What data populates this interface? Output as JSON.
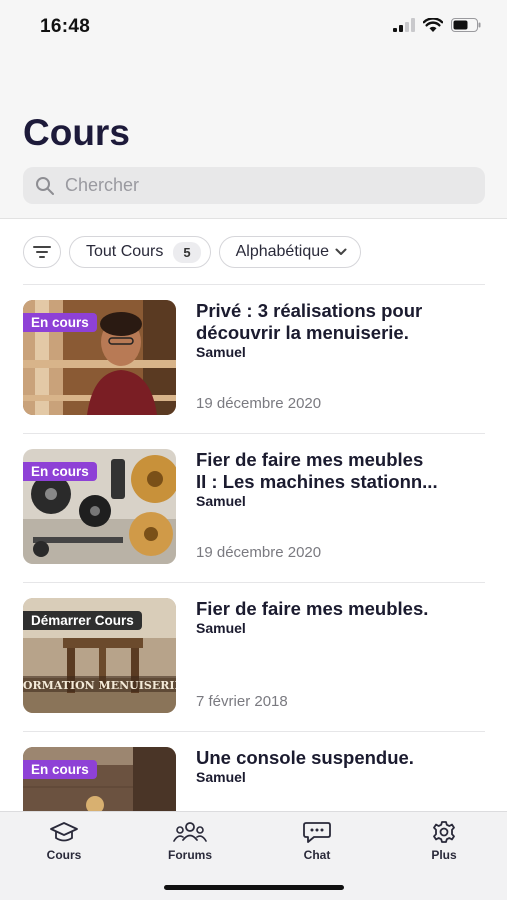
{
  "status_bar": {
    "time": "16:48"
  },
  "header": {
    "title": "Cours",
    "search_placeholder": "Chercher"
  },
  "filters": {
    "all_label": "Tout Cours",
    "all_count": "5",
    "sort_label": "Alphabétique"
  },
  "courses": [
    {
      "badge": "En cours",
      "title_line1": "Privé : 3 réalisations pour",
      "title_line2": "découvrir la menuiserie.",
      "author": "Samuel",
      "date": "19 décembre 2020"
    },
    {
      "badge": "En cours",
      "title_line1": "Fier de faire mes meubles",
      "title_line2": "II : Les machines stationn...",
      "author": "Samuel",
      "date": "19 décembre 2020"
    },
    {
      "badge": "Démarrer Cours",
      "title_line1": "Fier de faire mes meubles.",
      "author": "Samuel",
      "date": "7 février 2018",
      "thumb_text": "FORMATION MENUISERIE"
    },
    {
      "badge": "En cours",
      "title_line1": "Une console suspendue.",
      "author": "Samuel"
    }
  ],
  "tabs": [
    {
      "label": "Cours",
      "icon": "graduation-cap-icon"
    },
    {
      "label": "Forums",
      "icon": "group-icon"
    },
    {
      "label": "Chat",
      "icon": "chat-bubble-icon"
    },
    {
      "label": "Plus",
      "icon": "gear-icon"
    }
  ],
  "colors": {
    "accent_purple": "#8e41d6",
    "title_navy": "#1d1a3a",
    "badge_dark": "#2f2f2f"
  }
}
